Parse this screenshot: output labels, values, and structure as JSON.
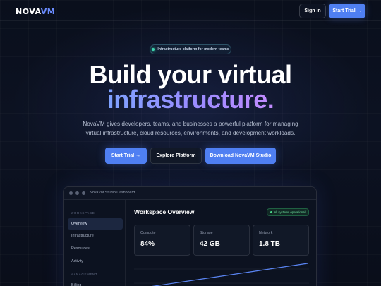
{
  "nav": {
    "logo_prefix": "NOVA",
    "logo_suffix": "VM",
    "signin_label": "Sign In",
    "trial_label": "Start Trial →"
  },
  "hero": {
    "badge": "Infrastructure platform for modern teams",
    "headline_line1": "Build your virtual",
    "headline_line2": "infrastructure.",
    "subtitle_line1": "NovaVM gives developers, teams, and businesses a powerful platform for managing",
    "subtitle_line2": "virtual infrastructure, cloud resources, environments, and development workloads.",
    "cta_trial": "Start Trial →",
    "cta_explore": "Explore Platform",
    "cta_download": "Download NovaVM Studio"
  },
  "dashboard": {
    "window_title": "NovaVM Studio Dashboard",
    "sidebar": {
      "section_workspace": "WORKSPACE",
      "items": [
        "Overview",
        "Infrastructure",
        "Resources",
        "Activity"
      ],
      "section_management": "MANAGEMENT",
      "items_management": [
        "Billing"
      ]
    },
    "main_title": "Workspace Overview",
    "status": "All systems operational",
    "stats": [
      {
        "label": "Compute",
        "value": "84%"
      },
      {
        "label": "Storage",
        "value": "42 GB"
      },
      {
        "label": "Network",
        "value": "1.8 TB"
      }
    ]
  },
  "colors": {
    "accent": "#4f7ff2",
    "status_green": "#4ad68a",
    "background": "#0a0f1c"
  }
}
